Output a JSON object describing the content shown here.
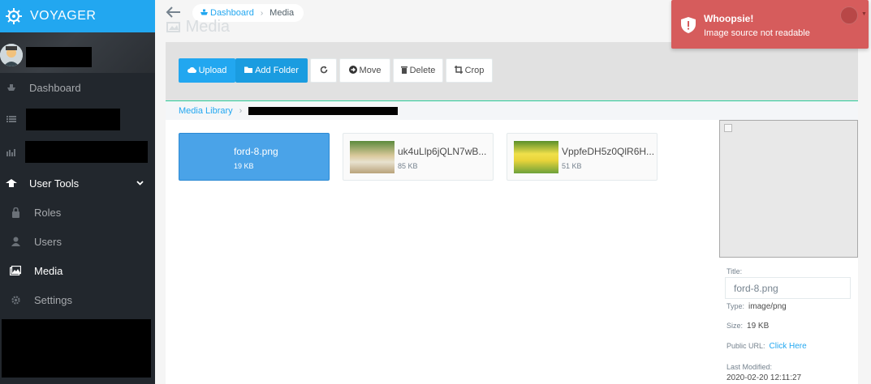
{
  "brand": {
    "name": "VOYAGER",
    "icon": "helm-icon"
  },
  "sidebar": {
    "items": [
      {
        "label": "Dashboard",
        "icon": "boat-icon"
      },
      {
        "label": "",
        "icon": "list-icon"
      },
      {
        "label": "",
        "icon": "bar-chart-icon"
      },
      {
        "label": "User Tools",
        "icon": "tools-icon"
      },
      {
        "label": "Roles",
        "icon": "lock-icon"
      },
      {
        "label": "Users",
        "icon": "person-icon"
      },
      {
        "label": "Media",
        "icon": "images-icon"
      },
      {
        "label": "Settings",
        "icon": "gear-icon"
      }
    ]
  },
  "topbar": {
    "home_label": "Dashboard",
    "current_label": "Media"
  },
  "page_title": "Media",
  "toolbar": {
    "upload_label": "Upload",
    "add_folder_label": "Add Folder",
    "move_label": "Move",
    "delete_label": "Delete",
    "crop_label": "Crop"
  },
  "media_breadcrumb": {
    "root_label": "Media Library"
  },
  "files": [
    {
      "name": "ford-8.png",
      "size": "19 KB"
    },
    {
      "name": "uk4uLlp6jQLN7wB...",
      "size": "85 KB"
    },
    {
      "name": "VppfeDH5z0QlR6H...",
      "size": "51 KB"
    }
  ],
  "info": {
    "title_label": "Title:",
    "title_value": "ford-8.png",
    "type_label": "Type:",
    "type_value": "image/png",
    "size_label": "Size:",
    "size_value": "19 KB",
    "url_label": "Public URL:",
    "url_link": "Click Here",
    "modified_label": "Last Modified:",
    "modified_value": "2020-02-20 12:11:27"
  },
  "toast": {
    "title": "Whoopsie!",
    "message": "Image source not readable"
  },
  "colors": {
    "accent": "#22a7f0",
    "sidebar": "#22272d",
    "toast": "#d65c5c",
    "selected": "#4aa3e8"
  }
}
